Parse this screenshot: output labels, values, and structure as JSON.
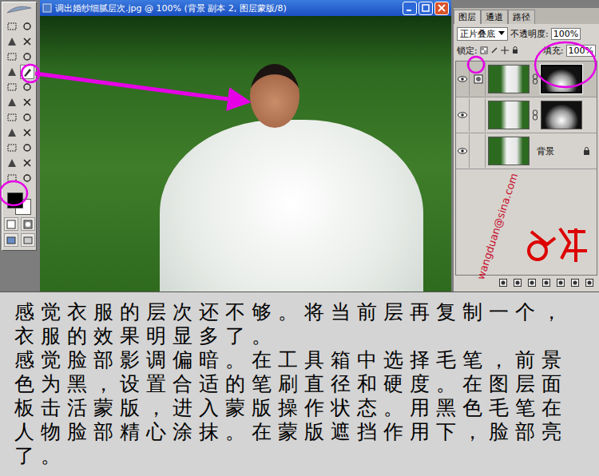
{
  "document": {
    "title": "调出婚纱细腻层次.jpg @ 100% (背景 副本 2, 图层蒙版/8)"
  },
  "toolbox": {
    "foreground_color": "#000000",
    "background_color": "#ffffff"
  },
  "layers_panel": {
    "tabs": [
      {
        "label": "图层",
        "selected": true
      },
      {
        "label": "通道",
        "selected": false
      },
      {
        "label": "路径",
        "selected": false
      }
    ],
    "blend_mode": "正片叠底",
    "opacity_label": "不透明度:",
    "opacity": "100%",
    "lock_label": "锁定:",
    "fill_label": "填充:",
    "fill": "100%",
    "layers": [
      {
        "name": "",
        "visible": true,
        "selected": true,
        "has_mask": true,
        "locked": false
      },
      {
        "name": "",
        "visible": true,
        "selected": false,
        "has_mask": true,
        "locked": false
      },
      {
        "name": "背景",
        "visible": true,
        "selected": false,
        "has_mask": false,
        "locked": true
      }
    ]
  },
  "watermark": "wangduan@sina.com",
  "caption": [
    "感觉衣服的层次还不够。将当前层再复制一个，衣服的效果明显多了。",
    "感觉脸部影调偏暗。在工具箱中选择毛笔，前景色为黑，设置合适的笔刷直径和硬度。在图层面板击活蒙版，进入蒙版操作状态。用黑色毛笔在人物脸部精心涂抹。在蒙版遮挡作用下，脸部亮了。"
  ]
}
